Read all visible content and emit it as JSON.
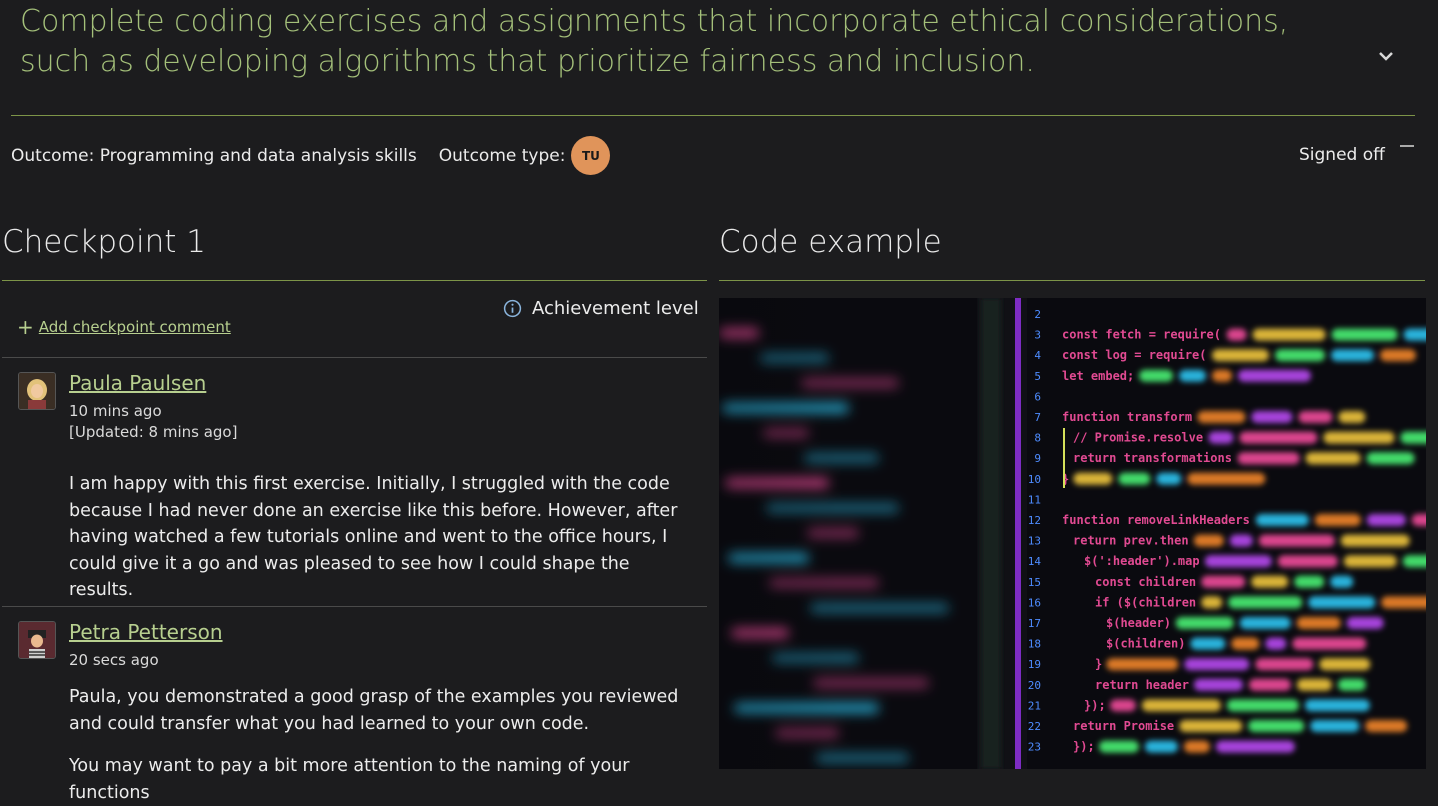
{
  "goal": {
    "title": "Complete coding exercises and assignments that incorporate ethical considerations, such as developing algorithms that prioritize fairness and inclusion."
  },
  "outcome": {
    "label": "Outcome: Programming and data analysis skills",
    "type_label": "Outcome type:",
    "type_badge": "TU",
    "status": "Signed off"
  },
  "checkpoint": {
    "title": "Checkpoint 1",
    "add_comment_label": "Add checkpoint comment",
    "achievement_label": "Achievement level"
  },
  "comments": [
    {
      "author": "Paula Paulsen",
      "time": "10 mins ago",
      "updated": "[Updated: 8 mins ago]",
      "paragraphs": [
        "I am happy with this first exercise. Initially, I struggled with the code because I had never done an exercise like this before. However, after having watched a few tutorials online and went to the office hours, I could give it a go and was pleased to see how I could shape the results."
      ]
    },
    {
      "author": "Petra Petterson",
      "time": "20 secs ago",
      "paragraphs": [
        "Paula, you demonstrated a good grasp of the examples you reviewed and could transfer what you had learned to your own code.",
        "You may want to pay a bit more attention to the naming of your functions"
      ]
    }
  ],
  "code_example": {
    "title": "Code example",
    "line_numbers": [
      "2",
      "3",
      "4",
      "5",
      "6",
      "7",
      "8",
      "9",
      "10",
      "11",
      "12",
      "13",
      "14",
      "15",
      "16",
      "17",
      "18",
      "19",
      "20",
      "21",
      "22",
      "23"
    ],
    "code_lines": [
      "const fetch = require(",
      "const log = require(",
      "let embed;",
      "",
      "function transform",
      "// Promise.resolve",
      "return transformations",
      "}",
      "",
      "function removeLinkHeaders",
      "return prev.then",
      "$(':header').map",
      "const children",
      "if ($(children",
      "$(header)",
      "$(children)",
      "}",
      "return header",
      "});",
      "return Promise",
      "});"
    ]
  },
  "colors": {
    "accent": "#a4c07a",
    "link": "#b7cf8f",
    "badge": "#e0945a",
    "background": "#1c1c1e"
  }
}
